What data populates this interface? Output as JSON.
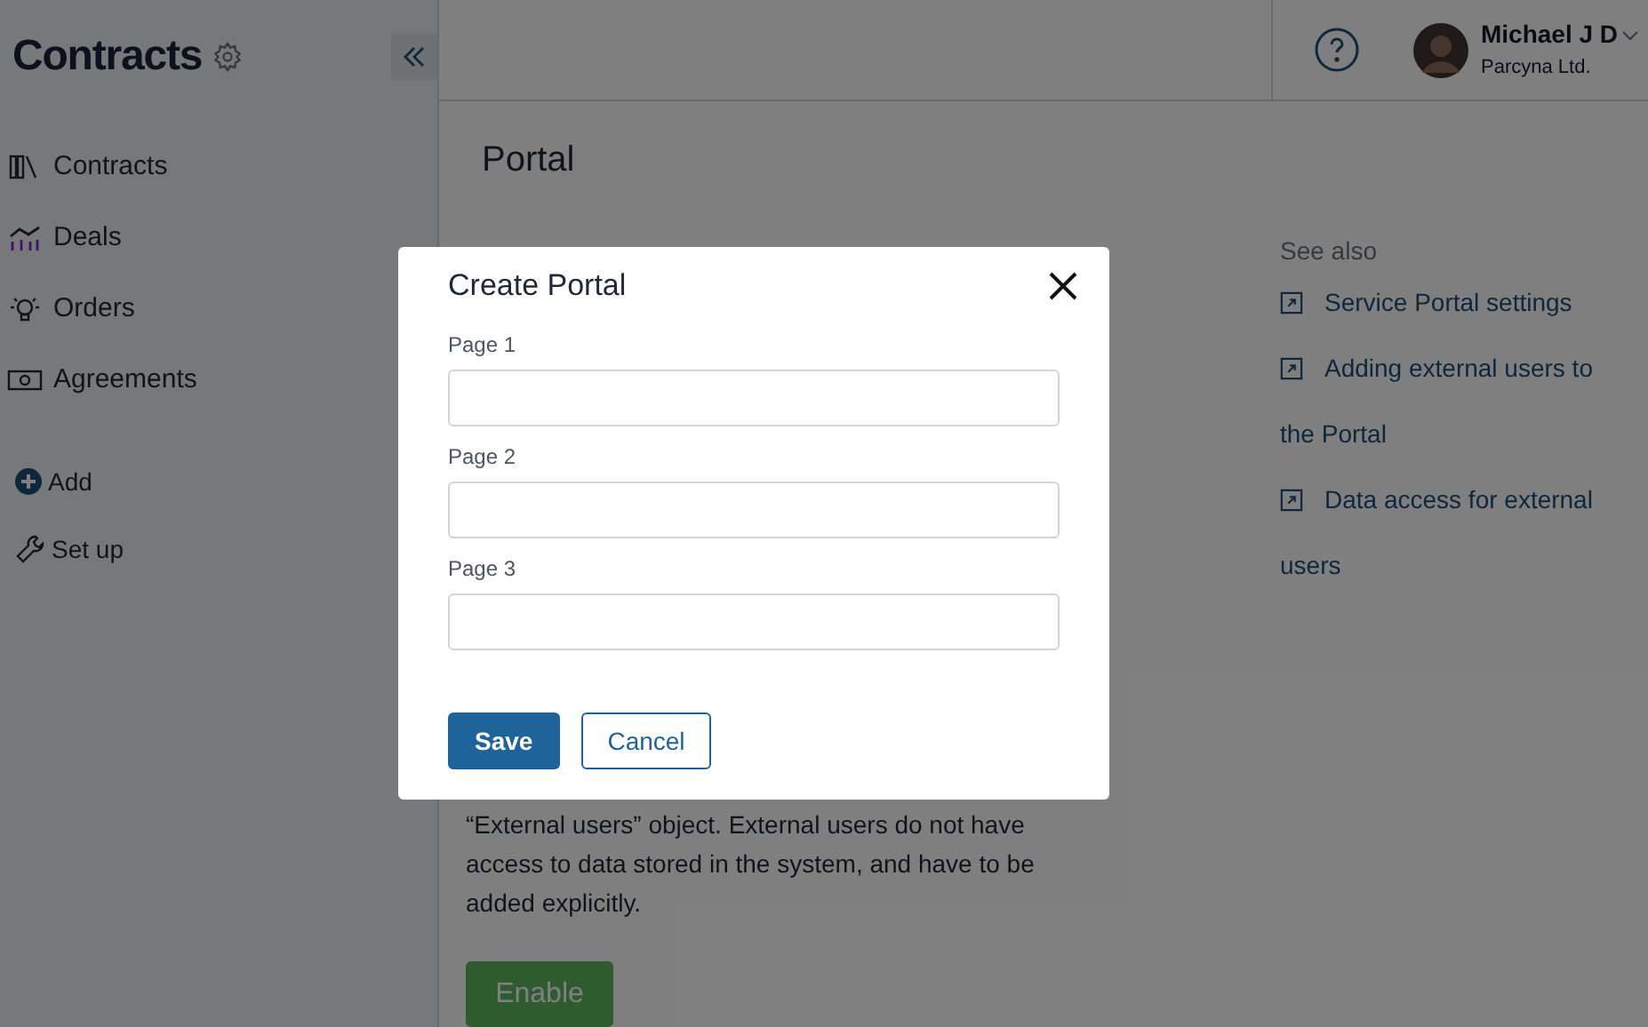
{
  "sidebar": {
    "title": "Contracts",
    "items": [
      {
        "label": "Contracts"
      },
      {
        "label": "Deals"
      },
      {
        "label": "Orders"
      },
      {
        "label": "Agreements"
      }
    ],
    "actions": [
      {
        "label": "Add"
      },
      {
        "label": "Set up"
      }
    ]
  },
  "header": {
    "user": {
      "name": "Michael J D",
      "company": "Parcyna Ltd."
    }
  },
  "page": {
    "title": "Portal",
    "description": "“External users” object. External users do not have access to data stored in the system, and have to be added explicitly.",
    "button": "Enable"
  },
  "see_also": {
    "title": "See also",
    "links": [
      "Service Portal settings",
      "Adding external users to the Portal",
      "Data access for external users"
    ]
  },
  "dialog": {
    "title": "Create Portal",
    "fields": [
      {
        "label": "Page 1"
      },
      {
        "label": "Page 2"
      },
      {
        "label": "Page 3"
      }
    ],
    "buttons": [
      {
        "label": "Save",
        "kind": "primary"
      },
      {
        "label": "Cancel",
        "kind": "secondary"
      }
    ]
  }
}
